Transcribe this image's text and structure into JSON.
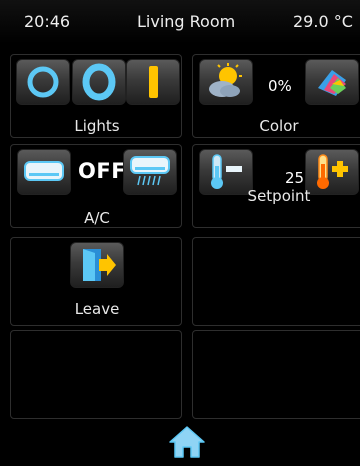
{
  "status": {
    "time": "20:46",
    "room": "Living Room",
    "temperature": "29.0 °C"
  },
  "tiles": {
    "lights": {
      "label": "Lights"
    },
    "color": {
      "label": "Color",
      "value": "0%"
    },
    "ac": {
      "label": "A/C",
      "state": "OFF"
    },
    "setpoint": {
      "label": "Setpoint",
      "value": "25.0"
    },
    "leave": {
      "label": "Leave"
    }
  },
  "colors": {
    "accent_blue": "#5cc8f5",
    "accent_yellow": "#ffc400",
    "tile_border": "#2e2e2e",
    "background": "#000000"
  },
  "icons": {
    "lights_off": "ring-thin-icon",
    "lights_on": "ring-thick-icon",
    "lights_dim": "bar-icon",
    "color_left": "sun-cloud-icon",
    "color_right": "color-palette-icon",
    "ac_left": "ac-unit-icon",
    "ac_right": "ac-unit-airflow-icon",
    "setpoint_down": "thermometer-minus-icon",
    "setpoint_up": "thermometer-plus-icon",
    "leave": "exit-door-icon",
    "home": "home-icon"
  }
}
